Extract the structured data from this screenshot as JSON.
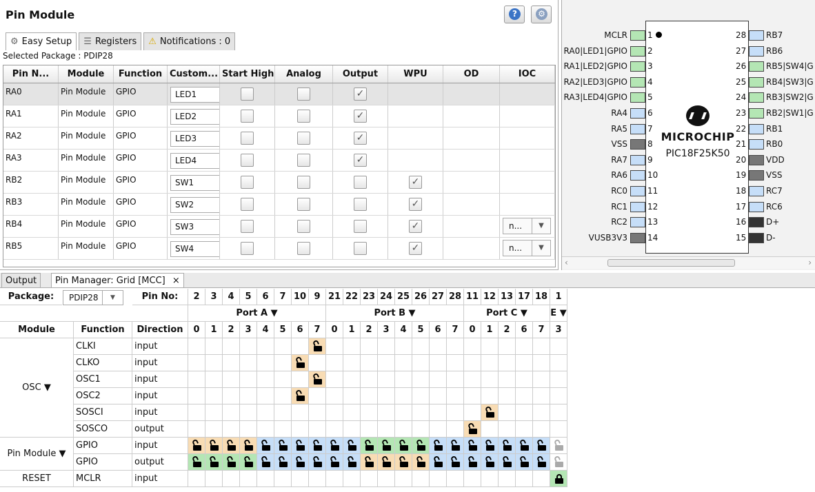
{
  "pin_module": {
    "title": "Pin Module",
    "help_icon": "?",
    "settings_icon": "⚙",
    "tabs": [
      {
        "label": "Easy Setup",
        "icon": "gear-icon"
      },
      {
        "label": "Registers",
        "icon": "registers-icon"
      },
      {
        "label": "Notifications : 0",
        "icon": "warning-icon"
      }
    ],
    "selected_package": "Selected Package : PDIP28",
    "columns": [
      "Pin N...",
      "Module",
      "Function",
      "Custom...",
      "Start High",
      "Analog",
      "Output",
      "WPU",
      "OD",
      "IOC"
    ],
    "rows": [
      {
        "pin": "RA0",
        "module": "Pin Module",
        "function": "GPIO",
        "custom": "LED1",
        "start_high": false,
        "analog": false,
        "output": true,
        "wpu": null,
        "ioc": null
      },
      {
        "pin": "RA1",
        "module": "Pin Module",
        "function": "GPIO",
        "custom": "LED2",
        "start_high": false,
        "analog": false,
        "output": true,
        "wpu": null,
        "ioc": null
      },
      {
        "pin": "RA2",
        "module": "Pin Module",
        "function": "GPIO",
        "custom": "LED3",
        "start_high": false,
        "analog": false,
        "output": true,
        "wpu": null,
        "ioc": null
      },
      {
        "pin": "RA3",
        "module": "Pin Module",
        "function": "GPIO",
        "custom": "LED4",
        "start_high": false,
        "analog": false,
        "output": true,
        "wpu": null,
        "ioc": null
      },
      {
        "pin": "RB2",
        "module": "Pin Module",
        "function": "GPIO",
        "custom": "SW1",
        "start_high": false,
        "analog": false,
        "output": false,
        "wpu": true,
        "ioc": null
      },
      {
        "pin": "RB3",
        "module": "Pin Module",
        "function": "GPIO",
        "custom": "SW2",
        "start_high": false,
        "analog": false,
        "output": false,
        "wpu": true,
        "ioc": null
      },
      {
        "pin": "RB4",
        "module": "Pin Module",
        "function": "GPIO",
        "custom": "SW3",
        "start_high": false,
        "analog": false,
        "output": false,
        "wpu": true,
        "ioc": "n..."
      },
      {
        "pin": "RB5",
        "module": "Pin Module",
        "function": "GPIO",
        "custom": "SW4",
        "start_high": false,
        "analog": false,
        "output": false,
        "wpu": true,
        "ioc": "n..."
      }
    ]
  },
  "diagram": {
    "logo": "MICROCHIP",
    "part": "PIC18F25K50",
    "left_pins": [
      {
        "n": "1",
        "label": "MCLR",
        "color": "#b4e6b4"
      },
      {
        "n": "2",
        "label": "RA0|LED1|GPIO",
        "color": "#b4e6b4"
      },
      {
        "n": "3",
        "label": "RA1|LED2|GPIO",
        "color": "#b4e6b4"
      },
      {
        "n": "4",
        "label": "RA2|LED3|GPIO",
        "color": "#b4e6b4"
      },
      {
        "n": "5",
        "label": "RA3|LED4|GPIO",
        "color": "#b4e6b4"
      },
      {
        "n": "6",
        "label": "RA4",
        "color": "#c6def8"
      },
      {
        "n": "7",
        "label": "RA5",
        "color": "#c6def8"
      },
      {
        "n": "8",
        "label": "VSS",
        "color": "#777777"
      },
      {
        "n": "9",
        "label": "RA7",
        "color": "#c6def8"
      },
      {
        "n": "10",
        "label": "RA6",
        "color": "#c6def8"
      },
      {
        "n": "11",
        "label": "RC0",
        "color": "#c6def8"
      },
      {
        "n": "12",
        "label": "RC1",
        "color": "#c6def8"
      },
      {
        "n": "13",
        "label": "RC2",
        "color": "#c6def8"
      },
      {
        "n": "14",
        "label": "VUSB3V3",
        "color": "#777777"
      }
    ],
    "right_pins": [
      {
        "n": "28",
        "label": "RB7",
        "color": "#c6def8"
      },
      {
        "n": "27",
        "label": "RB6",
        "color": "#c6def8"
      },
      {
        "n": "26",
        "label": "RB5|SW4|G",
        "color": "#b4e6b4"
      },
      {
        "n": "25",
        "label": "RB4|SW3|G",
        "color": "#b4e6b4"
      },
      {
        "n": "24",
        "label": "RB3|SW2|G",
        "color": "#b4e6b4"
      },
      {
        "n": "23",
        "label": "RB2|SW1|G",
        "color": "#b4e6b4"
      },
      {
        "n": "22",
        "label": "RB1",
        "color": "#c6def8"
      },
      {
        "n": "21",
        "label": "RB0",
        "color": "#c6def8"
      },
      {
        "n": "20",
        "label": "VDD",
        "color": "#777777"
      },
      {
        "n": "19",
        "label": "VSS",
        "color": "#777777"
      },
      {
        "n": "18",
        "label": "RC7",
        "color": "#c6def8"
      },
      {
        "n": "17",
        "label": "RC6",
        "color": "#c6def8"
      },
      {
        "n": "16",
        "label": "D+",
        "color": "#333333"
      },
      {
        "n": "15",
        "label": "D-",
        "color": "#333333"
      }
    ]
  },
  "bottom_tabs": [
    {
      "label": "Output"
    },
    {
      "label": "Pin Manager: Grid [MCC]",
      "close": "×"
    }
  ],
  "grid": {
    "package_label": "Package:",
    "package_value": "PDIP28",
    "pinno_label": "Pin No:",
    "pin_numbers": [
      "2",
      "3",
      "4",
      "5",
      "6",
      "7",
      "10",
      "9",
      "21",
      "22",
      "23",
      "24",
      "25",
      "26",
      "27",
      "28",
      "11",
      "12",
      "13",
      "17",
      "18",
      "1"
    ],
    "ports": [
      {
        "label": "Port A ▼"
      },
      {
        "label": "Port B ▼"
      },
      {
        "label": "Port C ▼"
      },
      {
        "label": "E ▼"
      }
    ],
    "bits": [
      "0",
      "1",
      "2",
      "3",
      "4",
      "5",
      "6",
      "7",
      "0",
      "1",
      "2",
      "3",
      "4",
      "5",
      "6",
      "7",
      "0",
      "1",
      "2",
      "6",
      "7",
      "3"
    ],
    "headers": {
      "module": "Module",
      "function": "Function",
      "direction": "Direction"
    },
    "modules": [
      {
        "label": "OSC ▼"
      },
      {
        "label": "Pin Module ▼"
      },
      {
        "label": "RESET"
      }
    ],
    "rows": [
      {
        "function": "CLKI",
        "direction": "input",
        "cells": {
          "7": "O"
        }
      },
      {
        "function": "CLKO",
        "direction": "input",
        "cells": {
          "6": "O"
        }
      },
      {
        "function": "OSC1",
        "direction": "input",
        "cells": {
          "7": "O"
        }
      },
      {
        "function": "OSC2",
        "direction": "input",
        "cells": {
          "6": "O"
        }
      },
      {
        "function": "SOSCI",
        "direction": "input",
        "cells": {
          "17": "O"
        }
      },
      {
        "function": "SOSCO",
        "direction": "output",
        "cells": {
          "16": "O"
        }
      },
      {
        "function": "GPIO",
        "direction": "input",
        "cells": {
          "0": "O",
          "1": "O",
          "2": "O",
          "3": "O",
          "4": "B",
          "5": "B",
          "6": "B",
          "7": "B",
          "8": "B",
          "9": "B",
          "10": "G",
          "11": "G",
          "12": "G",
          "13": "G",
          "14": "B",
          "15": "B",
          "16": "B",
          "17": "B",
          "18": "B",
          "19": "B",
          "20": "B",
          "21": "X"
        }
      },
      {
        "function": "GPIO",
        "direction": "output",
        "cells": {
          "0": "G",
          "1": "G",
          "2": "G",
          "3": "G",
          "4": "B",
          "5": "B",
          "6": "B",
          "7": "B",
          "8": "B",
          "9": "B",
          "10": "O",
          "11": "O",
          "12": "O",
          "13": "O",
          "14": "B",
          "15": "B",
          "16": "B",
          "17": "B",
          "18": "B",
          "19": "B",
          "20": "B",
          "21": "X"
        }
      },
      {
        "function": "MCLR",
        "direction": "input",
        "cells": {
          "21": "GC"
        }
      }
    ]
  },
  "colors": {
    "orange": "#f8dcb4",
    "blue": "#c6def8",
    "green": "#b4e6b4"
  }
}
